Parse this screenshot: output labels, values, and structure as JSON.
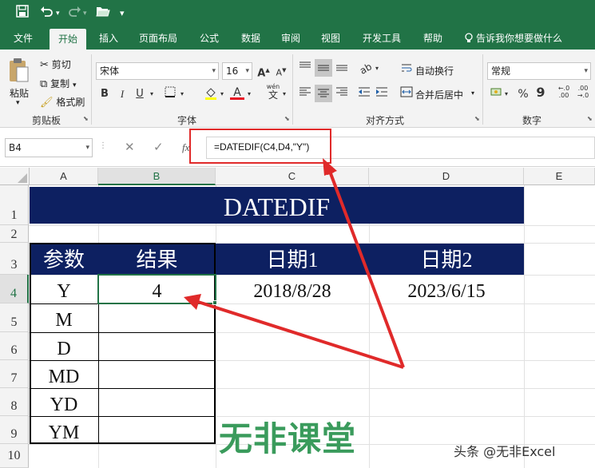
{
  "quick_access": {
    "save": "save-icon",
    "undo": "undo-icon",
    "redo": "redo-icon",
    "open": "open-icon",
    "more": "▾"
  },
  "tabs": [
    "文件",
    "开始",
    "插入",
    "页面布局",
    "公式",
    "数据",
    "审阅",
    "视图",
    "开发工具",
    "帮助",
    "告诉我你想要做什么"
  ],
  "ribbon": {
    "clipboard": {
      "paste": "粘贴",
      "cut": "剪切",
      "copy": "复制",
      "format_painter": "格式刷",
      "label": "剪贴板"
    },
    "font": {
      "name": "宋体",
      "size": "16",
      "bold": "B",
      "italic": "I",
      "underline": "U",
      "wen": "wén",
      "wen2": "文",
      "label": "字体"
    },
    "alignment": {
      "wrap": "自动换行",
      "merge": "合并后居中",
      "label": "对齐方式"
    },
    "number": {
      "format": "常规",
      "percent": "%",
      "comma": "9",
      "inc": "←.0\n.00",
      "dec": ".00\n→.0",
      "label": "数字"
    }
  },
  "formula_bar": {
    "name_box": "B4",
    "formula": "=DATEDIF(C4,D4,\"Y\")",
    "fx": "fx"
  },
  "columns": [
    "A",
    "B",
    "C",
    "D",
    "E"
  ],
  "rows": [
    "1",
    "2",
    "3",
    "4",
    "5",
    "6",
    "7",
    "8",
    "9",
    "10"
  ],
  "sheet": {
    "title": "DATEDIF",
    "headers": [
      "参数",
      "结果",
      "日期1",
      "日期2"
    ],
    "params": [
      "Y",
      "M",
      "D",
      "MD",
      "YD",
      "YM"
    ],
    "result_b4": "4",
    "date1": "2018/8/28",
    "date2": "2023/6/15"
  },
  "watermark": "无非课堂",
  "attribution": "头条 @无非Excel",
  "colors": {
    "excel_green": "#217346",
    "navy": "#0d2061",
    "arrow": "#e02a2a"
  }
}
